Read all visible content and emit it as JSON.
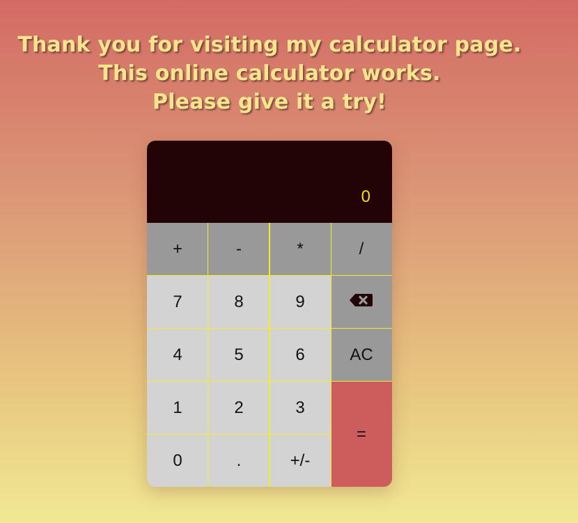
{
  "header": {
    "lines": [
      "Thank you for visiting my calculator page.",
      "This online calculator works.",
      "Please give it a try!"
    ]
  },
  "calculator": {
    "display": "0",
    "operators": [
      "+",
      "-",
      "*",
      "/"
    ],
    "row1": [
      "7",
      "8",
      "9"
    ],
    "row2": [
      "4",
      "5",
      "6"
    ],
    "row3": [
      "1",
      "2",
      "3"
    ],
    "row4": [
      "0",
      ".",
      "+/-"
    ],
    "clear_label": "AC",
    "equals_label": "=",
    "backspace_icon": "backspace-icon"
  },
  "colors": {
    "background_top": "#d36b64",
    "background_bottom": "#f0e894",
    "headline_text": "#f7e58e",
    "display_bg": "#220306",
    "display_text": "#f2e00c",
    "operator_key": "#999999",
    "number_key": "#d3d3d3",
    "equals_key": "#cd5c5c",
    "grid_lines": "#f3ee22"
  }
}
